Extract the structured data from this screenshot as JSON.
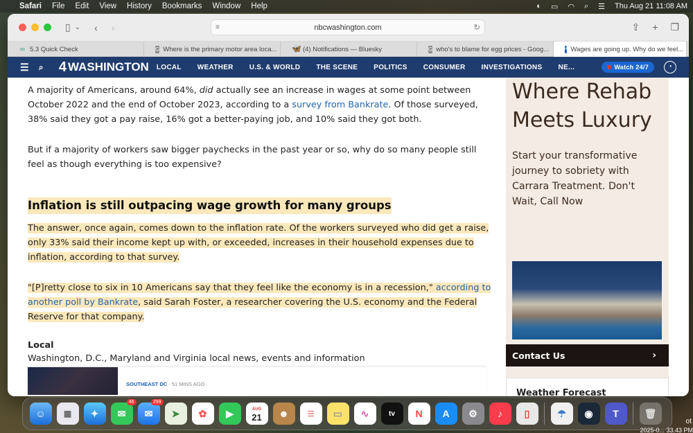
{
  "menubar": {
    "app": "Safari",
    "items": [
      "File",
      "Edit",
      "View",
      "History",
      "Bookmarks",
      "Window",
      "Help"
    ],
    "datetime": "Thu Aug 21  11:08 AM"
  },
  "browser": {
    "url": "nbcwashington.com",
    "tabs": [
      {
        "label": "5.3 Quick Check",
        "icon": "infinity"
      },
      {
        "label": "Where is the primary motor area loca...",
        "icon": "G"
      },
      {
        "label": "(4) Notifications — Bluesky",
        "icon": "butterfly"
      },
      {
        "label": "who's to blame for egg prices - Goog...",
        "icon": "G"
      },
      {
        "label": "Wages are going up. Why do we feel...",
        "icon": "4"
      }
    ]
  },
  "nbc": {
    "logo": "WASHINGTON",
    "logo_num": "4",
    "nav": [
      "LOCAL",
      "WEATHER",
      "U.S. & WORLD",
      "THE SCENE",
      "POLITICS",
      "CONSUMER",
      "INVESTIGATIONS",
      "NE..."
    ],
    "watch": "Watch 24/7"
  },
  "article": {
    "p1_a": "A majority of Americans, around 64%, ",
    "p1_em": "did",
    "p1_b": " actually see an increase in wages at some point between October 2022 and the end of October 2023, according to a ",
    "p1_link": "survey from Bankrate",
    "p1_c": ". Of those surveyed, 38% said they got a pay raise, 16% got a better-paying job, and 10% said they got both.",
    "p2": "But if a majority of workers saw bigger paychecks in the past year or so, why do so many people still feel as though everything is too expensive?",
    "h2": "Inflation is still outpacing wage growth for many groups",
    "p3": "The answer, once again, comes down to the inflation rate. Of the workers surveyed who did get a raise, only 33% said their income kept up with, or exceeded, increases in their household expenses due to inflation, according to that survey.",
    "p4_a": "\"[P]retty close to six in 10 Americans say that they feel like the economy is in a recession,\" ",
    "p4_link": "according to another poll by Bankrate",
    "p4_b": ", said Sarah Foster, a researcher covering the U.S. economy and the Federal Reserve for that company.",
    "local_title": "Local",
    "local_desc": "Washington, D.C., Maryland and Virginia local news, events and information",
    "card_section": "SOUTHEAST DC",
    "card_time": "· 51 MINS AGO"
  },
  "ad": {
    "headline": "Where Rehab Meets Luxury",
    "body": "Start your transformative journey to sobriety with Carrara Treatment. Don't Wait, Call Now",
    "cta": "Contact Us"
  },
  "weather": "Weather Forecast",
  "dock": {
    "badges": {
      "messages": "46",
      "mail": "299"
    },
    "calendar_month": "AUG",
    "calendar_day": "21"
  },
  "desktop": {
    "partial1": "ot",
    "partial2": "2025-0... 33.43 PM"
  }
}
